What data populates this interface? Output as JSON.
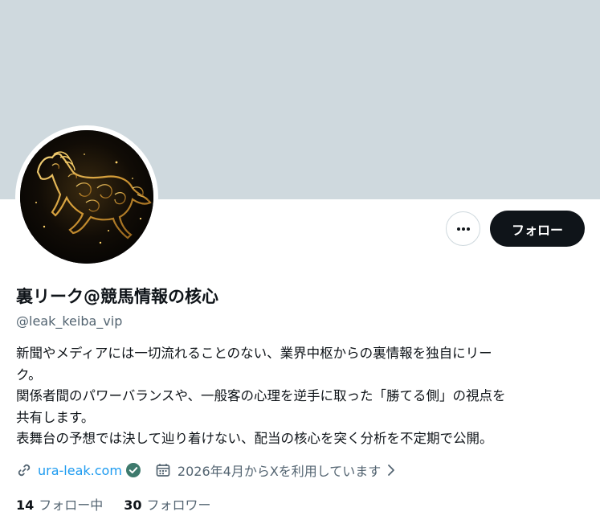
{
  "profile": {
    "display_name": "裏リーク@競馬情報の核心",
    "handle": "@leak_keiba_vip",
    "bio_lines": [
      "新聞やメディアには一切流れることのない、業界中枢からの裏情報を独自にリー",
      "ク。",
      "関係者間のパワーバランスや、一般客の心理を逆手に取った「勝てる側」の視点を",
      "共有します。",
      "表舞台の予想では決して辿り着けない、配当の核心を突く分析を不定期で公開。"
    ],
    "website": "ura-leak.com",
    "joined": "2026年4月からXを利用しています",
    "following_count": "14",
    "following_label": "フォロー中",
    "followers_count": "30",
    "followers_label": "フォロワー"
  },
  "actions": {
    "follow_label": "フォロー"
  },
  "icons": {
    "more": "more-horizontal-icon",
    "link": "link-icon",
    "verified": "verified-check-icon",
    "calendar": "calendar-icon",
    "chevron": "chevron-right-icon"
  },
  "colors": {
    "banner": "#cfd9de",
    "link": "#1d9bf0",
    "secondary_text": "#536471",
    "primary_text": "#0f1419",
    "verified": "#3e7a6d",
    "horse_gold": "#d9a441"
  }
}
